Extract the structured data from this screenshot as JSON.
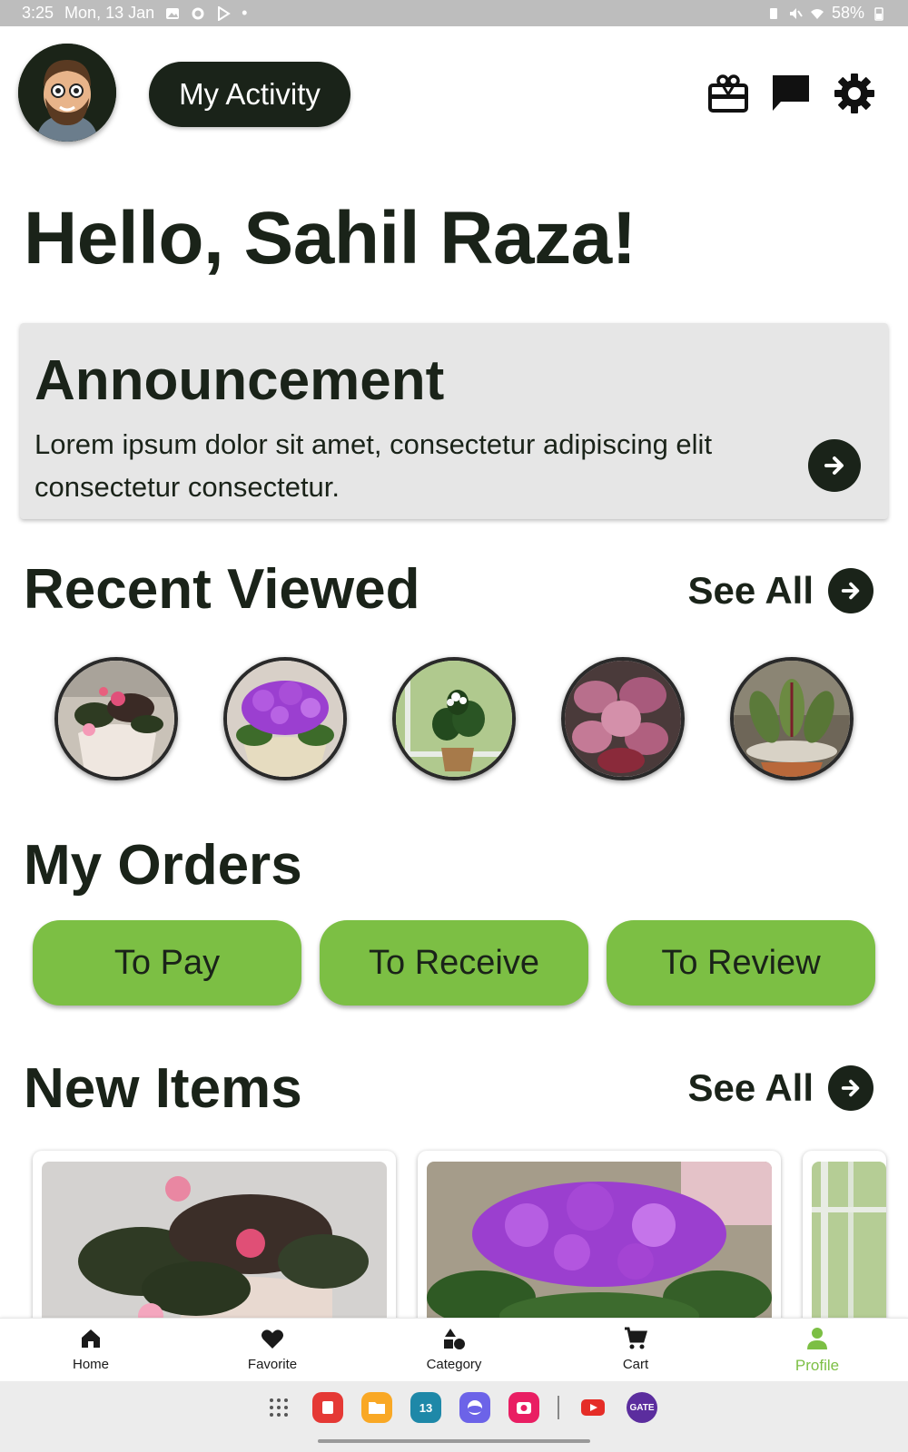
{
  "status_bar": {
    "time": "3:25",
    "date": "Mon, 13 Jan",
    "battery": "58%"
  },
  "header": {
    "activity_label": "My Activity"
  },
  "greeting": "Hello, Sahil Raza!",
  "announcement": {
    "title": "Announcement",
    "body": "Lorem ipsum dolor sit amet, consectetur adipiscing elit consectetur consectetur."
  },
  "recent": {
    "title": "Recent Viewed",
    "see_all": "See All",
    "items": [
      "begonia",
      "african-violet",
      "jasmine",
      "polka-dot-plant",
      "prayer-plant"
    ]
  },
  "orders": {
    "title": "My Orders",
    "buttons": [
      "To Pay",
      "To Receive",
      "To Review"
    ]
  },
  "new_items": {
    "title": "New Items",
    "see_all": "See All"
  },
  "nav": {
    "items": [
      "Home",
      "Favorite",
      "Category",
      "Cart",
      "Profile"
    ],
    "active": "Profile"
  },
  "taskbar": {
    "calendar_day": "13",
    "gate_label": "GATE"
  },
  "colors": {
    "primary_dark": "#1a2319",
    "accent_green": "#7cbf44",
    "announcement_bg": "#e6e6e6"
  }
}
